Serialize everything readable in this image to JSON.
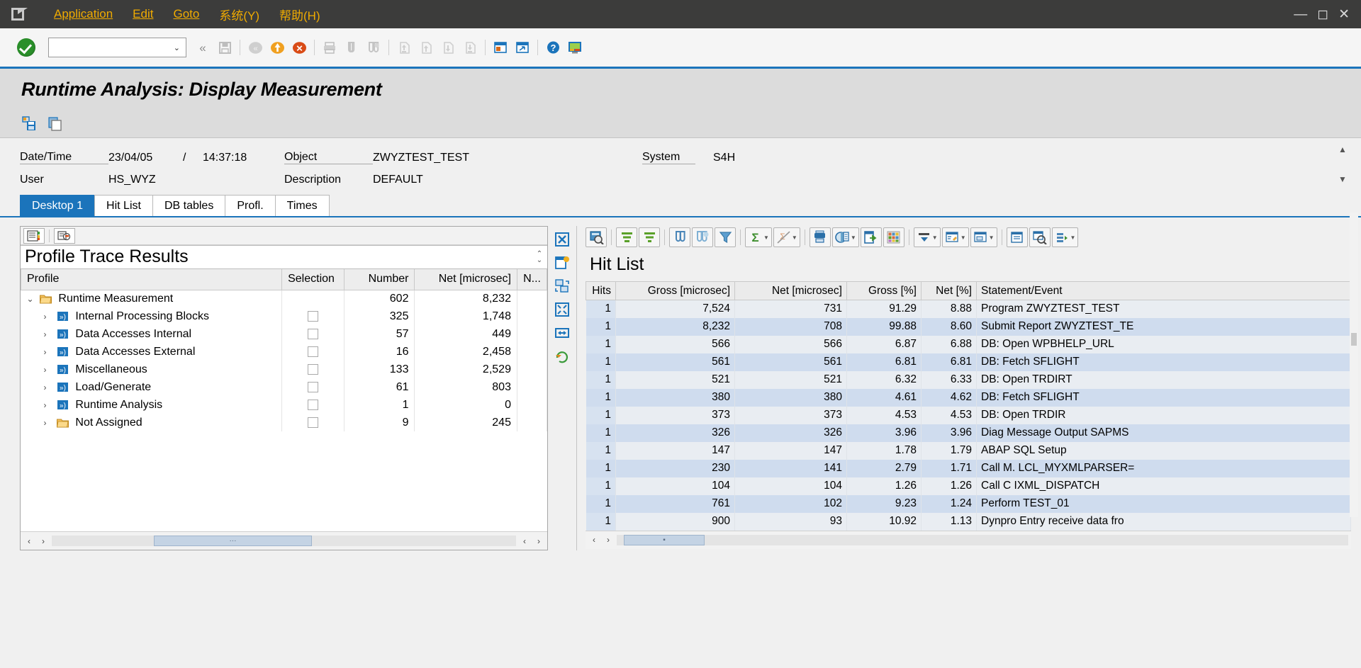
{
  "window": {
    "minimize": "—",
    "maximize": "◻",
    "close": "✕"
  },
  "menu": {
    "items": [
      {
        "label": "Application",
        "accel": "A"
      },
      {
        "label": "Edit",
        "accel": "E"
      },
      {
        "label": "Goto",
        "accel": "G"
      },
      {
        "label": "系统(Y)",
        "accel": "Y"
      },
      {
        "label": "帮助(H)",
        "accel": "H"
      }
    ]
  },
  "system_toolbar": {
    "enter_icon": "green-check-icon",
    "command_field_value": "",
    "command_field_placeholder": "",
    "buttons": [
      {
        "name": "back-chevrons",
        "glyph": "«"
      },
      {
        "name": "save-icon",
        "glyph": "save"
      },
      {
        "name": "back-icon",
        "glyph": "back"
      },
      {
        "name": "exit-icon",
        "glyph": "exit"
      },
      {
        "name": "cancel-icon",
        "glyph": "cancel"
      },
      {
        "name": "print-icon",
        "glyph": "print"
      },
      {
        "name": "find-icon",
        "glyph": "find"
      },
      {
        "name": "find-next-icon",
        "glyph": "find-next"
      },
      {
        "name": "first-page-icon",
        "glyph": "first"
      },
      {
        "name": "previous-page-icon",
        "glyph": "prev"
      },
      {
        "name": "next-page-icon",
        "glyph": "next"
      },
      {
        "name": "last-page-icon",
        "glyph": "last"
      },
      {
        "name": "create-session-icon",
        "glyph": "session"
      },
      {
        "name": "create-shortcut-icon",
        "glyph": "shortcut"
      },
      {
        "name": "help-icon",
        "glyph": "help"
      },
      {
        "name": "customize-local-layout-icon",
        "glyph": "layout"
      }
    ]
  },
  "page": {
    "title": "Runtime Analysis: Display Measurement",
    "app_toolbar": [
      {
        "name": "save-measurement-button",
        "icon": "save-variant-icon"
      },
      {
        "name": "copy-button",
        "icon": "copy-icon"
      }
    ]
  },
  "info": {
    "row1": {
      "label_datetime": "Date/Time",
      "date": "23/04/05",
      "separator": "/",
      "time": "14:37:18",
      "label_object": "Object",
      "object": "ZWYZTEST_TEST",
      "label_system": "System",
      "system": "S4H"
    },
    "row2": {
      "label_user": "User",
      "user": "HS_WYZ",
      "label_description": "Description",
      "description": "DEFAULT"
    },
    "scroll_up": "▲",
    "scroll_down": "▼"
  },
  "tabs": [
    {
      "label": "Desktop 1",
      "active": true
    },
    {
      "label": "Hit List",
      "active": false
    },
    {
      "label": "DB tables",
      "active": false
    },
    {
      "label": "Profl.",
      "active": false
    },
    {
      "label": "Times",
      "active": false
    }
  ],
  "tree_panel": {
    "toolbar": [
      {
        "name": "detail-view-icon"
      },
      {
        "name": "filter-settings-icon"
      }
    ],
    "title": "Profile Trace Results",
    "columns": [
      "Profile",
      "Selection",
      "Number",
      "Net [microsec]",
      "N..."
    ],
    "rows": [
      {
        "label": "Runtime Measurement",
        "icon": "folder-icon",
        "level": 0,
        "expanded": true,
        "has_checkbox": false,
        "number": "602",
        "net": "8,232",
        "n": ""
      },
      {
        "label": "Internal Processing Blocks",
        "icon": "node-icon",
        "level": 1,
        "expanded": false,
        "has_checkbox": true,
        "number": "325",
        "net": "1,748",
        "n": ""
      },
      {
        "label": "Data Accesses Internal",
        "icon": "node-icon",
        "level": 1,
        "expanded": false,
        "has_checkbox": true,
        "number": "57",
        "net": "449",
        "n": ""
      },
      {
        "label": "Data Accesses External",
        "icon": "node-icon",
        "level": 1,
        "expanded": false,
        "has_checkbox": true,
        "number": "16",
        "net": "2,458",
        "n": ""
      },
      {
        "label": "Miscellaneous",
        "icon": "node-icon",
        "level": 1,
        "expanded": false,
        "has_checkbox": true,
        "number": "133",
        "net": "2,529",
        "n": ""
      },
      {
        "label": "Load/Generate",
        "icon": "node-icon",
        "level": 1,
        "expanded": false,
        "has_checkbox": true,
        "number": "61",
        "net": "803",
        "n": ""
      },
      {
        "label": "Runtime Analysis",
        "icon": "node-icon",
        "level": 1,
        "expanded": false,
        "has_checkbox": true,
        "number": "1",
        "net": "0",
        "n": ""
      },
      {
        "label": "Not Assigned",
        "icon": "folder-icon",
        "level": 1,
        "expanded": false,
        "has_checkbox": true,
        "number": "9",
        "net": "245",
        "n": ""
      }
    ],
    "scroll": {
      "left_arrow": "‹",
      "right_arrow": "›",
      "thumb_dots": "···"
    },
    "side_buttons": [
      {
        "name": "close-panel-icon"
      },
      {
        "name": "new-window-icon"
      },
      {
        "name": "move-rows-icon"
      },
      {
        "name": "fullscreen-icon"
      },
      {
        "name": "resize-width-icon"
      },
      {
        "name": "refresh-icon"
      }
    ]
  },
  "hit_list": {
    "toolbar": [
      {
        "name": "detail-magnifier-icon"
      },
      {
        "name": "sort-ascending-icon"
      },
      {
        "name": "sort-descending-icon"
      },
      {
        "name": "find-icon"
      },
      {
        "name": "find-next-icon"
      },
      {
        "name": "filter-icon"
      },
      {
        "name": "total-sum-icon",
        "has_caret": true
      },
      {
        "name": "subtotal-icon",
        "has_caret": true
      },
      {
        "name": "print-preview-icon"
      },
      {
        "name": "view-icon",
        "has_caret": true
      },
      {
        "name": "export-icon"
      },
      {
        "name": "microsoft-excel-icon"
      },
      {
        "name": "layout-select-icon",
        "has_caret": true
      },
      {
        "name": "change-layout-icon"
      },
      {
        "name": "save-layout-icon",
        "has_caret": true
      },
      {
        "name": "info-icon"
      },
      {
        "name": "zoom-icon"
      },
      {
        "name": "more-options-icon",
        "has_caret": true
      }
    ],
    "title": "Hit List",
    "columns": [
      "Hits",
      "Gross [microsec]",
      "Net [microsec]",
      "Gross [%]",
      "Net [%]",
      "Statement/Event"
    ],
    "rows": [
      {
        "hits": "1",
        "gross": "7,524",
        "net": "731",
        "gross_pct": "91.29",
        "net_pct": "8.88",
        "statement": "Program ZWYZTEST_TEST"
      },
      {
        "hits": "1",
        "gross": "8,232",
        "net": "708",
        "gross_pct": "99.88",
        "net_pct": "8.60",
        "statement": "Submit Report ZWYZTEST_TE"
      },
      {
        "hits": "1",
        "gross": "566",
        "net": "566",
        "gross_pct": "6.87",
        "net_pct": "6.88",
        "statement": "DB: Open WPBHELP_URL"
      },
      {
        "hits": "1",
        "gross": "561",
        "net": "561",
        "gross_pct": "6.81",
        "net_pct": "6.81",
        "statement": "DB: Fetch SFLIGHT"
      },
      {
        "hits": "1",
        "gross": "521",
        "net": "521",
        "gross_pct": "6.32",
        "net_pct": "6.33",
        "statement": "DB: Open TRDIRT"
      },
      {
        "hits": "1",
        "gross": "380",
        "net": "380",
        "gross_pct": "4.61",
        "net_pct": "4.62",
        "statement": "DB: Fetch SFLIGHT"
      },
      {
        "hits": "1",
        "gross": "373",
        "net": "373",
        "gross_pct": "4.53",
        "net_pct": "4.53",
        "statement": "DB: Open TRDIR"
      },
      {
        "hits": "1",
        "gross": "326",
        "net": "326",
        "gross_pct": "3.96",
        "net_pct": "3.96",
        "statement": "Diag Message Output SAPMS"
      },
      {
        "hits": "1",
        "gross": "147",
        "net": "147",
        "gross_pct": "1.78",
        "net_pct": "1.79",
        "statement": "ABAP SQL Setup"
      },
      {
        "hits": "1",
        "gross": "230",
        "net": "141",
        "gross_pct": "2.79",
        "net_pct": "1.71",
        "statement": "Call M. LCL_MYXMLPARSER="
      },
      {
        "hits": "1",
        "gross": "104",
        "net": "104",
        "gross_pct": "1.26",
        "net_pct": "1.26",
        "statement": "Call C IXML_DISPATCH"
      },
      {
        "hits": "1",
        "gross": "761",
        "net": "102",
        "gross_pct": "9.23",
        "net_pct": "1.24",
        "statement": "Perform TEST_01"
      },
      {
        "hits": "1",
        "gross": "900",
        "net": "93",
        "gross_pct": "10.92",
        "net_pct": "1.13",
        "statement": "Dynpro Entry receive data fro"
      }
    ],
    "scroll": {
      "left_arrow": "‹",
      "right_arrow": "›",
      "thumb_dots": "▪"
    }
  },
  "colors": {
    "menubar_bg": "#3c3c3b",
    "menu_text": "#f0ab00",
    "accent_blue": "#1b74bb",
    "header_bg": "#dcdcdc",
    "row_odd": "#e9edf2",
    "row_even": "#cfdcee"
  }
}
